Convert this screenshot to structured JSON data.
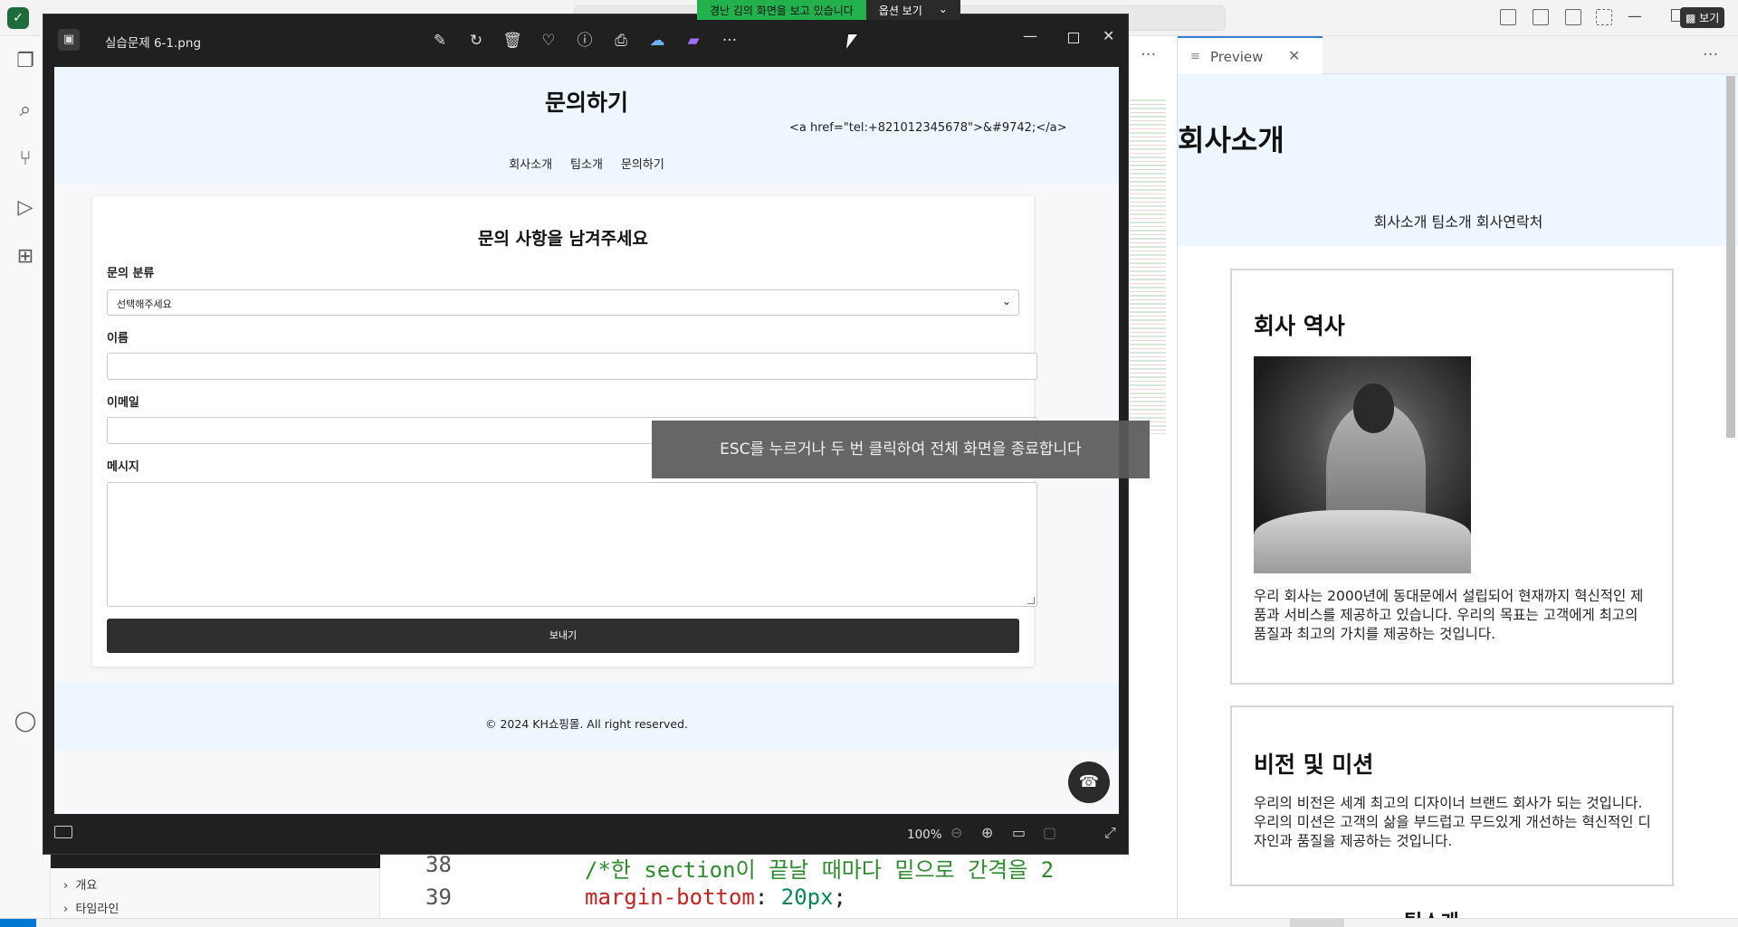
{
  "share_bar": {
    "text": "경난 김의 화면을 보고 있습니다",
    "options": "옵션 보기",
    "options_chevron": "⌄"
  },
  "vscode": {
    "save_badge": "▩ 보기",
    "outline": [
      "개요",
      "타임라인"
    ],
    "editor": {
      "line_numbers": [
        "38",
        "39"
      ],
      "code_38": "/*한 section이 끝날 때마다 밑으로 간격을 2",
      "code_39_prop": "margin-bottom",
      "code_39_colon": ": ",
      "code_39_val": "20px",
      "code_39_semi": ";"
    },
    "preview": {
      "tab_label": "Preview",
      "title": "회사소개",
      "nav": "회사소개 팀소개 회사연락처",
      "history_title": "회사 역사",
      "history_text": "우리 회사는 2000년에 동대문에서 설립되어 현재까지 혁신적인 제품과 서비스를 제공하고 있습니다. 우리의 목표는 고객에게 최고의 품질과 최고의 가치를 제공하는 것입니다.",
      "vision_title": "비전 및 미션",
      "vision_text": "우리의 비전은 세계 최고의 디자이너 브랜드 회사가 되는 것입니다. 우리의 미션은 고객의 삶을 부드럽고 무드있게 개선하는 혁신적인 디자인과 품질을 제공하는 것입니다.",
      "next_title": "팀소개"
    }
  },
  "viewer": {
    "filename": "실습문제 6-1.png",
    "zoom": "100%",
    "esc_toast": "ESC를 누르거나 두 번 클릭하여 전체 화면을 종료합니다",
    "toolbar_icons": [
      "edit-image-icon",
      "rotate-icon",
      "delete-icon",
      "favorite-icon",
      "info-icon",
      "print-icon",
      "onedrive-icon",
      "clipchamp-icon",
      "more-icon"
    ]
  },
  "site": {
    "title": "문의하기",
    "nav": [
      "회사소개",
      "팀소개",
      "문의하기"
    ],
    "form_title": "문의 사항을 남겨주세요",
    "labels": {
      "category": "문의 분류",
      "name": "이름",
      "email": "이메일",
      "message": "메시지"
    },
    "category_selected": "선택해주세요",
    "send": "보내기",
    "footer_copy": "© 2024 KH쇼핑몰. All right reserved.",
    "footer_code": "<a href=\"tel:+821012345678\">&#9742;</a>",
    "phone_fab": "☎"
  },
  "colors": {
    "share_green": "#22b14c",
    "viewer_bg": "#202020",
    "site_header_bg": "#eef6ff",
    "send_button": "#2f2f2f",
    "toast_bg": "#5a5a5a"
  }
}
